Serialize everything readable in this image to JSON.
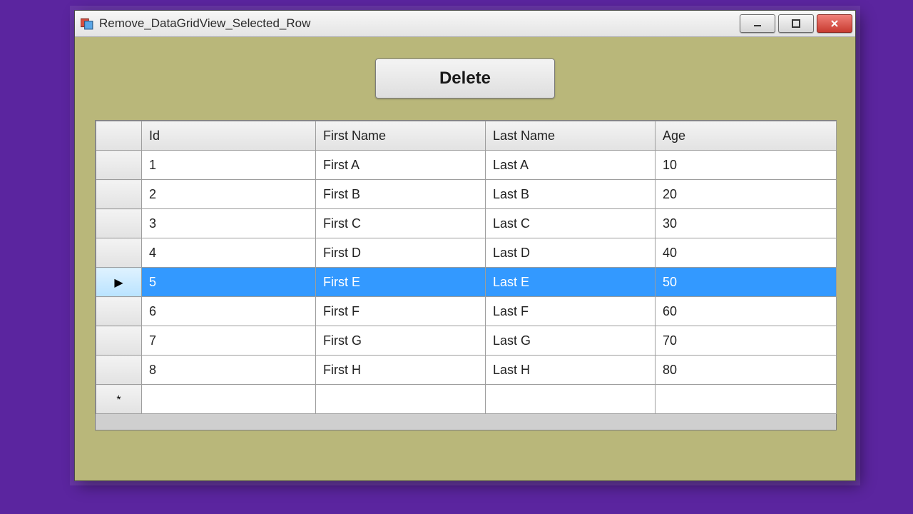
{
  "window": {
    "title": "Remove_DataGridView_Selected_Row"
  },
  "toolbar": {
    "delete_label": "Delete"
  },
  "grid": {
    "columns": [
      "Id",
      "First Name",
      "Last Name",
      "Age"
    ],
    "selected_index": 4,
    "rows": [
      {
        "id": "1",
        "first": "First A",
        "last": "Last A",
        "age": "10"
      },
      {
        "id": "2",
        "first": "First B",
        "last": "Last B",
        "age": "20"
      },
      {
        "id": "3",
        "first": "First C",
        "last": "Last C",
        "age": "30"
      },
      {
        "id": "4",
        "first": "First D",
        "last": "Last D",
        "age": "40"
      },
      {
        "id": "5",
        "first": "First E",
        "last": "Last E",
        "age": "50"
      },
      {
        "id": "6",
        "first": "First F",
        "last": "Last F",
        "age": "60"
      },
      {
        "id": "7",
        "first": "First G",
        "last": "Last G",
        "age": "70"
      },
      {
        "id": "8",
        "first": "First H",
        "last": "Last H",
        "age": "80"
      }
    ],
    "new_row_glyph": "*",
    "selected_row_glyph": "▶"
  }
}
